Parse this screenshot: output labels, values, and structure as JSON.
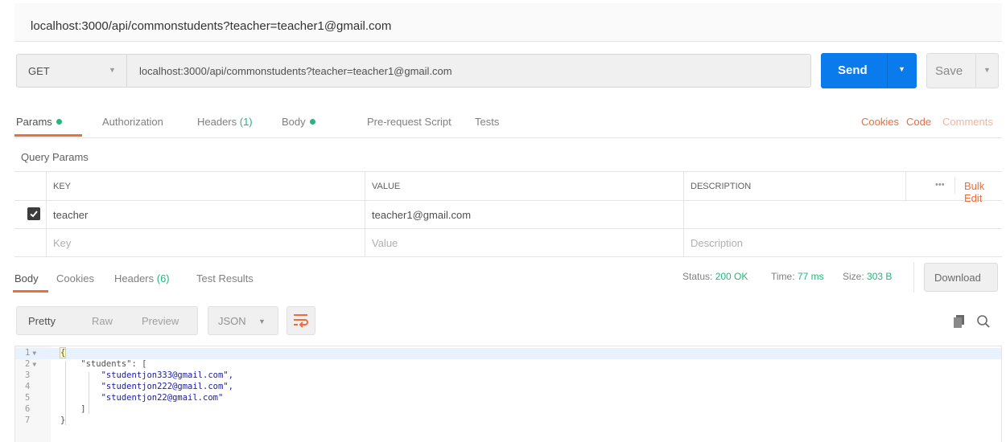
{
  "request_tab": {
    "title": "localhost:3000/api/commonstudents?teacher=teacher1@gmail.com"
  },
  "url_bar": {
    "method": "GET",
    "url": "localhost:3000/api/commonstudents?teacher=teacher1@gmail.com",
    "send_label": "Send",
    "save_label": "Save"
  },
  "request_tabs": [
    {
      "label": "Params",
      "dot": true,
      "active": true
    },
    {
      "label": "Authorization"
    },
    {
      "label": "Headers ",
      "count": "(1)"
    },
    {
      "label": "Body",
      "dot": true
    },
    {
      "label": "Pre-request Script"
    },
    {
      "label": "Tests"
    }
  ],
  "request_links": {
    "cookies": "Cookies",
    "code": "Code",
    "comments": "Comments"
  },
  "query_params": {
    "title": "Query Params",
    "headers": {
      "key": "KEY",
      "value": "VALUE",
      "description": "DESCRIPTION",
      "more": "•••",
      "bulk_edit": "Bulk Edit"
    },
    "rows": [
      {
        "checked": true,
        "key": "teacher",
        "value": "teacher1@gmail.com",
        "description": ""
      }
    ],
    "placeholder": {
      "key": "Key",
      "value": "Value",
      "description": "Description"
    }
  },
  "response": {
    "tabs": [
      {
        "label": "Body",
        "active": true
      },
      {
        "label": "Cookies"
      },
      {
        "label": "Headers ",
        "count": "(6)"
      },
      {
        "label": "Test Results"
      }
    ],
    "status_label": "Status:",
    "status_value": "200 OK",
    "time_label": "Time:",
    "time_value": "77 ms",
    "size_label": "Size:",
    "size_value": "303 B",
    "download_label": "Download",
    "view_modes": [
      "Pretty",
      "Raw",
      "Preview"
    ],
    "active_view": "Pretty",
    "format": "JSON",
    "code_lines": [
      "{",
      "    \"students\": [",
      "        \"studentjon333@gmail.com\",",
      "        \"studentjon222@gmail.com\",",
      "        \"studentjon22@gmail.com\"",
      "    ]",
      "}"
    ],
    "line_numbers": [
      "1",
      "2",
      "3",
      "4",
      "5",
      "6",
      "7"
    ]
  },
  "colors": {
    "accent": "#f26b3a",
    "send": "#097bed",
    "success": "#26b47f"
  },
  "icons": [
    "caret-down-icon",
    "check-icon",
    "wrap-lines-icon",
    "copy-icon",
    "search-icon"
  ]
}
